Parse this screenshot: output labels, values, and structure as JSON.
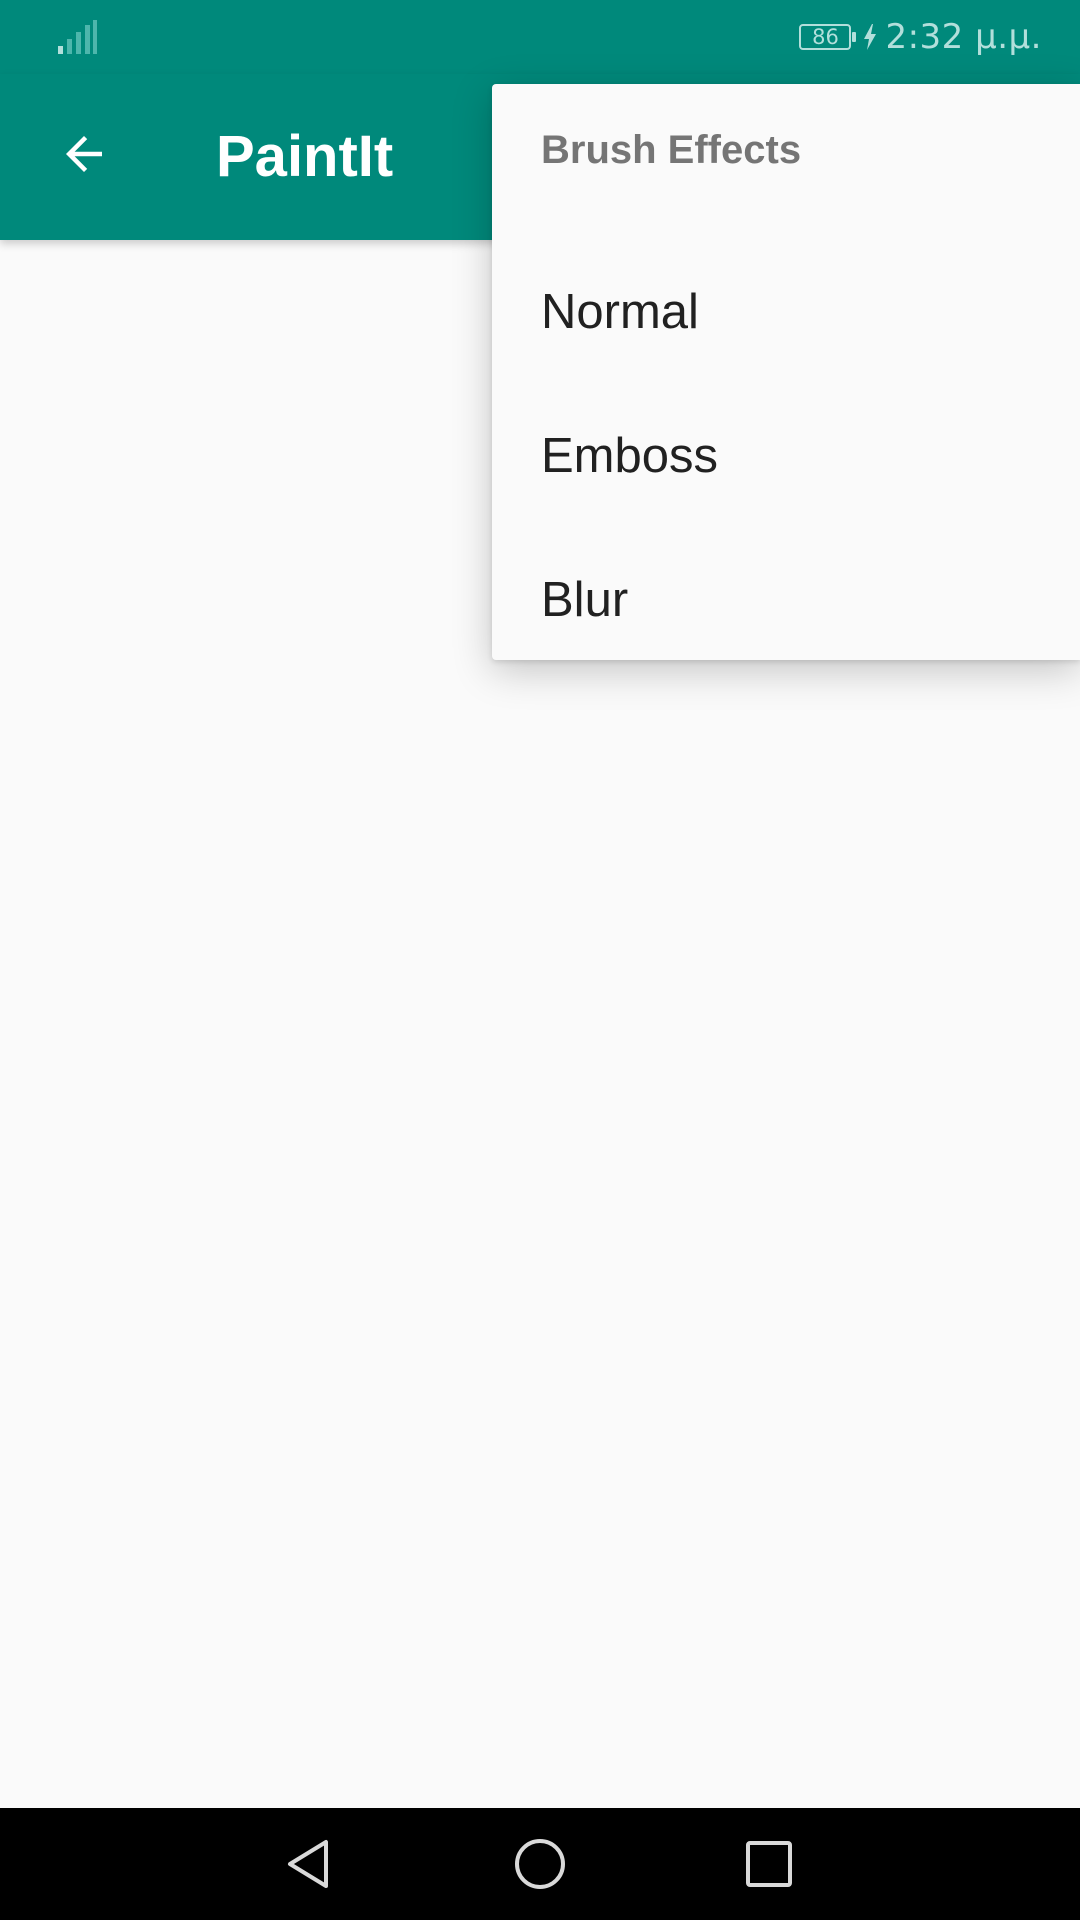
{
  "status_bar": {
    "battery_level": "86",
    "time": "2:32 μ.μ.",
    "signal_icon": "signal-strength-icon",
    "charging_icon": "charging-bolt-icon"
  },
  "app_bar": {
    "title": "PaintIt",
    "back_icon": "arrow-back-icon"
  },
  "menu": {
    "header": "Brush Effects",
    "items": [
      {
        "label": "Normal"
      },
      {
        "label": "Emboss"
      },
      {
        "label": "Blur"
      }
    ]
  },
  "nav_bar": {
    "back_icon": "nav-back-triangle-icon",
    "home_icon": "nav-home-circle-icon",
    "recents_icon": "nav-recents-square-icon"
  },
  "colors": {
    "primary": "#00897b",
    "background": "#fafafa",
    "menu_text": "#212121",
    "menu_header_text": "#757575",
    "status_text": "#b2dfdb"
  }
}
